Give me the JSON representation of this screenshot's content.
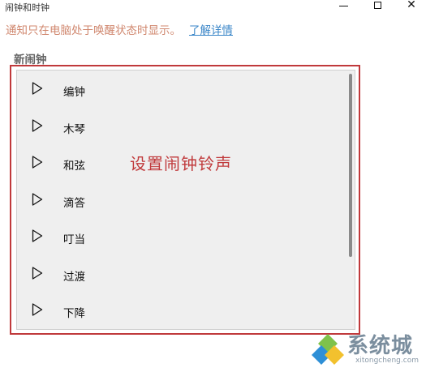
{
  "window": {
    "title": "闹钟和时钟",
    "controls": {
      "minimize_icon": "minimize-icon",
      "maximize_icon": "maximize-icon",
      "close_icon": "close-icon",
      "close_glyph": "✕"
    }
  },
  "notice": {
    "text": "通知只在电脑处于唤醒状态时显示。",
    "link": "了解详情",
    "text_color": "#d0876e",
    "link_color": "#3a86c8"
  },
  "section_label": "新闹钟",
  "sound_list": {
    "items": [
      {
        "label": "编钟",
        "icon": "play-icon"
      },
      {
        "label": "木琴",
        "icon": "play-icon"
      },
      {
        "label": "和弦",
        "icon": "play-icon"
      },
      {
        "label": "滴答",
        "icon": "play-icon"
      },
      {
        "label": "叮当",
        "icon": "play-icon"
      },
      {
        "label": "过渡",
        "icon": "play-icon"
      },
      {
        "label": "下降",
        "icon": "play-icon"
      }
    ],
    "highlight_color": "#c0393b"
  },
  "annotation": "设置闹钟铃声",
  "watermark": {
    "name": "系统城",
    "url": "xitongcheng.com"
  }
}
